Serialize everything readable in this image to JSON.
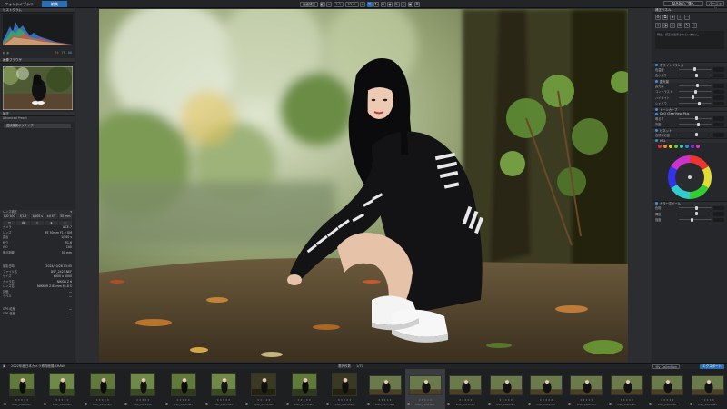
{
  "topbar": {
    "tab_library": "フォトライブラリ",
    "tab_edit": "編集",
    "zoom_label": "画面補正",
    "zoom_value": "53 %",
    "ratio": "1:1",
    "buy_button": "製品版のご購入",
    "version_label": "バージョン"
  },
  "left": {
    "histogram_title": "ヒストグラム",
    "histogram_values": [
      "74",
      "79",
      "68"
    ],
    "loupe_title": "画像ブラウザ",
    "tools_title": "補正",
    "preset_title": "Advanced Preset",
    "preset_value": "連続撮影ポジテイブ",
    "lens_section": "レンズ補正",
    "rows": [
      {
        "k": "カメラ",
        "v": "ILCE-7"
      },
      {
        "k": "レンズ",
        "v": "FE 50mm F1.2 GM"
      },
      {
        "k": "露出",
        "v": "1/500 s"
      },
      {
        "k": "絞り",
        "v": "f/1.6"
      },
      {
        "k": "ISO",
        "v": "100"
      },
      {
        "k": "焦点距離",
        "v": "50 mm"
      }
    ],
    "lens_buttons": [
      "ISO 100",
      "f/1.6",
      "1/500 s",
      "±0 EV",
      "50 mm"
    ],
    "meta": [
      {
        "k": "撮影日時",
        "v": "2024/10/28 13:45"
      },
      {
        "k": "ファイル名",
        "v": "DSF_2423.NEF"
      },
      {
        "k": "サイズ",
        "v": "6000 x 4000"
      },
      {
        "k": "カメラ名",
        "v": "NIKON Z 6"
      },
      {
        "k": "レンズ名",
        "v": "NIKKOR Z 85mm f/1.8 S"
      },
      {
        "k": "評価",
        "v": "—"
      },
      {
        "k": "ラベル",
        "v": "—"
      },
      {
        "k": "GPS 緯度",
        "v": "—"
      },
      {
        "k": "GPS 経度",
        "v": "—"
      }
    ]
  },
  "right": {
    "panel_title": "補正パネル",
    "note": "現在、補正は適用されていません。",
    "sections": [
      "ホワイトバランス",
      "露光量",
      "トーンカーブ",
      "DxO ClearView Plus",
      "ビネット",
      "HSL",
      "カラーホイール"
    ],
    "sliders": [
      "色温度",
      "色かぶり",
      "露光量",
      "コントラスト",
      "ハイライト",
      "シャドウ",
      "明るさ",
      "彩度",
      "自然な彩度",
      "色相",
      "輝度",
      "強度",
      "半径",
      "境界"
    ],
    "colors": [
      "#d33",
      "#e83",
      "#dc3",
      "#6c3",
      "#3ca",
      "#38d",
      "#73d",
      "#d3b"
    ]
  },
  "filmbar": {
    "label_left": "2022年度日本カメラ博物館展示RAW",
    "count": "選択枚数",
    "count_value": "1/70",
    "btn_collection": "My Collection",
    "btn_export": "エクスポート"
  },
  "filmstrip": [
    {
      "name": "DSC_2468.NEF",
      "tone": "g1"
    },
    {
      "name": "DSC_2469.NEF",
      "tone": "g2"
    },
    {
      "name": "DSC_2470.NEF",
      "tone": "g1"
    },
    {
      "name": "DSC_2471.NEF",
      "tone": "g2"
    },
    {
      "name": "DSC_2472.NEF",
      "tone": "g1"
    },
    {
      "name": "DSC_2473.NEF",
      "tone": "g2"
    },
    {
      "name": "DSC_2474.NEF",
      "tone": "g3"
    },
    {
      "name": "DSC_2475.NEF",
      "tone": "g1"
    },
    {
      "name": "DSC_2476.NEF",
      "tone": "g3"
    },
    {
      "name": "DSC_2477.NEF",
      "tone": "w"
    },
    {
      "name": "DSC_2478.NEF",
      "tone": "w",
      "sel": true
    },
    {
      "name": "DSC_2479.NEF",
      "tone": "w"
    },
    {
      "name": "DSC_2480.NEF",
      "tone": "w"
    },
    {
      "name": "DSC_2481.NEF",
      "tone": "w"
    },
    {
      "name": "DSC_2482.NEF",
      "tone": "w"
    },
    {
      "name": "DSC_2483.NEF",
      "tone": "w"
    },
    {
      "name": "DSC_2484.NEF",
      "tone": "w"
    },
    {
      "name": "DSC_2485.NEF",
      "tone": "w"
    }
  ]
}
